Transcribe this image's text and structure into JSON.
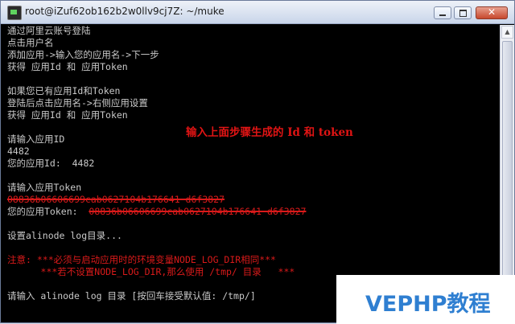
{
  "window": {
    "title": "root@iZuf62ob162b2w0llv9cj7Z: ~/muke"
  },
  "terminal": {
    "lines": [
      "通过阿里云账号登陆",
      "点击用户名",
      "添加应用->输入您的应用名->下一步",
      "获得 应用Id 和 应用Token",
      "",
      "如果您已有应用Id和Token",
      "登陆后点击应用名->右侧应用设置",
      "获得 应用Id 和 应用Token",
      "",
      "请输入应用ID",
      "4482",
      "您的应用Id:  4482",
      "",
      "请输入应用Token",
      "08836b06606699cab0627104b176641 d6f3827",
      "您的应用Token:",
      "",
      "设置alinode log目录...",
      "",
      "注意: ***必须与启动应用时的环境变量NODE_LOG_DIR相同***",
      "      ***若不设置NODE_LOG_DIR,那么使用 /tmp/ 目录   ***",
      "",
      "请输入 alinode log 目录 [按回车接受默认值: /tmp/]"
    ],
    "token_redacted": "08836b06606699cab0627104b176641 d6f3827"
  },
  "annotation": "输入上面步骤生成的 Id 和 token",
  "watermark": "VEPHP教程",
  "colors": {
    "terminal_bg": "#000000",
    "terminal_text": "#c9c9c9",
    "warning": "#d91a1a",
    "watermark": "#2f7fd1"
  }
}
